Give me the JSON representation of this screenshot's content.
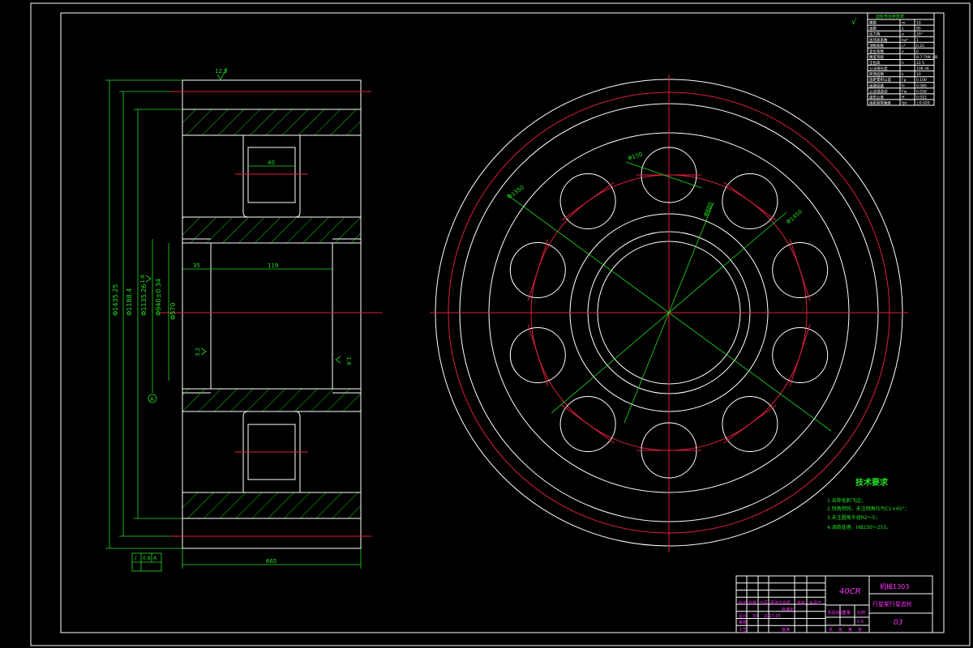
{
  "side_view": {
    "dims": {
      "top_roughness": "12.5",
      "width_slot": "40",
      "left_len": "35",
      "mid_len": "119",
      "right_roughness": "1.6",
      "left_roughness": "1.6",
      "bore_roughness": "3.2",
      "total_len": "665",
      "d1": "Φ1435.25",
      "d2": "Φ1188.4",
      "d3": "Φ1135.26",
      "d4": "Φ940±0.34",
      "d5": "Φ570",
      "datum": "A",
      "gdt_sym": "/",
      "gdt_val": "0.8",
      "gdt_ref": "A"
    }
  },
  "front_view": {
    "dims": {
      "hole_dia": "Φ150",
      "hole_pitch": "Φ1350",
      "outer": "Φ1450",
      "inner": "Φ880"
    }
  },
  "roughness_mark": "√",
  "tech_requirements": {
    "title": "技术要求",
    "items": [
      "1.去除毛刺飞边；",
      "2.锐角倒钝，未注倒角均为C1×45°；",
      "3.未注圆角半径R2～5；",
      "4.调质处理，HB230～255。"
    ]
  },
  "param_table": {
    "title": "齿轮传动参数表",
    "rows": [
      [
        "模数",
        "m",
        "10"
      ],
      [
        "齿数",
        "z",
        "85"
      ],
      [
        "压力角",
        "α",
        "20°"
      ],
      [
        "齿顶高系数",
        "ha*",
        "1"
      ],
      [
        "顶隙系数",
        "c*",
        "0.25"
      ],
      [
        "变位系数",
        "x",
        "0"
      ],
      [
        "精度等级",
        "",
        "8-7-7HK GB"
      ],
      [
        "全齿高",
        "h",
        "22.5"
      ],
      [
        "公法线长度",
        "",
        "108.36"
      ],
      [
        "跨测齿数",
        "k",
        "10"
      ],
      [
        "齿距累积公差",
        "Fp",
        "0.100"
      ],
      [
        "齿圈径跳",
        "Fr",
        "0.080"
      ],
      [
        "公法线变动",
        "Fw",
        "0.056"
      ],
      [
        "齿形公差",
        "ff",
        "0.022"
      ],
      [
        "齿距极限偏差",
        "fpt",
        "±0.020"
      ]
    ]
  },
  "title_block": {
    "material": "40CR",
    "school": "机械1303",
    "drawing_name": "行星架行星齿轮",
    "drawing_no": "03",
    "scale": "1:5",
    "row_labels": [
      "标记",
      "设计",
      "审核",
      "工艺"
    ],
    "col_labels": [
      "处数",
      "分区",
      "更改文件号",
      "签名",
      "年月日"
    ],
    "designer": "XX",
    "date": "2017.05",
    "stage_labels": [
      "阶段标记",
      "重量",
      "比例"
    ],
    "sheet_labels": [
      "共",
      "张",
      "第",
      "张"
    ],
    "standard": "标准化",
    "approve": "批准"
  }
}
